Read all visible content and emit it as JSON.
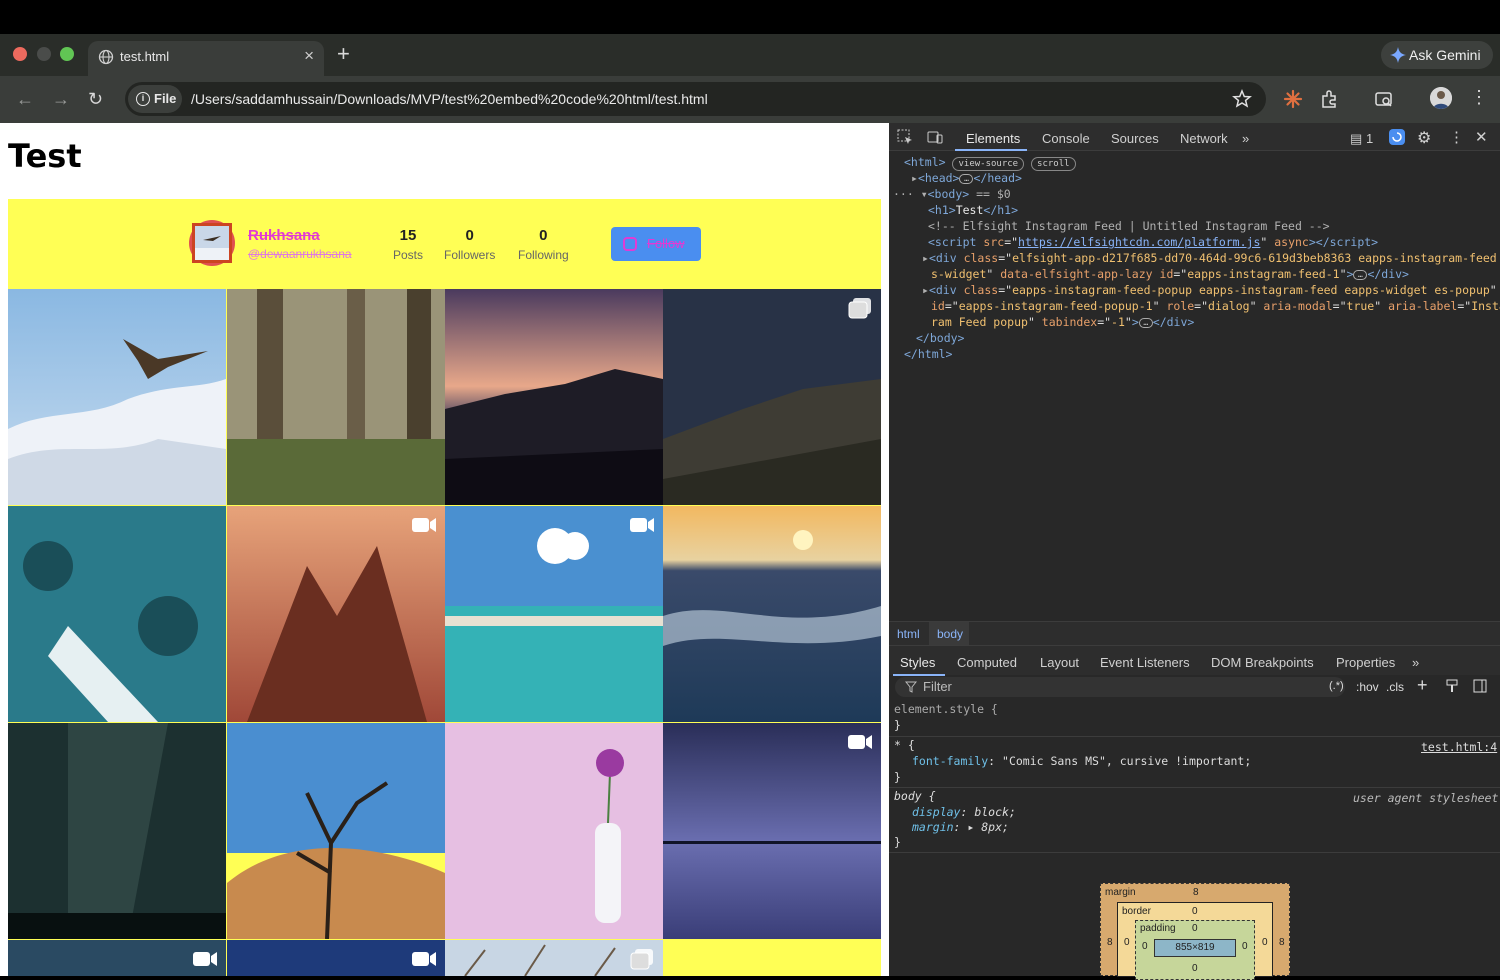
{
  "browser": {
    "tab_title": "test.html",
    "new_tab_symbol": "+",
    "gemini_label": "Ask Gemini",
    "file_chip": "File",
    "url": "/Users/saddamhussain/Downloads/MVP/test%20embed%20code%20html/test.html"
  },
  "page": {
    "heading": "Test",
    "profile": {
      "name": "Rukhsana",
      "handle": "@dewaanrukhsana",
      "posts": "15",
      "posts_label": "Posts",
      "followers": "0",
      "followers_label": "Followers",
      "following": "0",
      "following_label": "Following",
      "follow_label": "Follow"
    }
  },
  "devtools": {
    "tabs": [
      "Elements",
      "Console",
      "Sources",
      "Network"
    ],
    "issues_count": "1",
    "breadcrumb": [
      "html",
      "body"
    ],
    "style_tabs": [
      "Styles",
      "Computed",
      "Layout",
      "Event Listeners",
      "DOM Breakpoints",
      "Properties"
    ],
    "filter_placeholder": "Filter",
    "filter_controls": [
      ":hov",
      ".cls"
    ],
    "regex_toggle": "(.*)",
    "dom": {
      "view_source": "view-source",
      "scroll": "scroll",
      "body_selected": "== $0",
      "h1_text": "Test",
      "comment": "<!-- Elfsight Instagram Feed | Untitled Instagram Feed -->",
      "script_src": "https://elfsightcdn.com/platform.js",
      "div1_class": "elfsight-app-d217f685-dd70-464d-99c6-619d3beb8363 eapps-instagram-feed e",
      "div1_class_cont": "s-widget",
      "div1_id": "eapps-instagram-feed-1",
      "div2_class": "eapps-instagram-feed-popup eapps-instagram-feed eapps-widget es-popup",
      "div2_id": "eapps-instagram-feed-popup-1",
      "div2_role": "dialog",
      "div2_aria_modal": "true",
      "div2_aria_label": "Instag",
      "div2_aria_label_cont": "ram Feed popup",
      "div2_tabindex": "-1"
    },
    "styles": {
      "element_style": "element.style {",
      "rule1_selector": "* {",
      "rule1_source": "test.html:4",
      "rule1_prop": "font-family",
      "rule1_value": "\"Comic Sans MS\", cursive !important;",
      "rule2_selector": "body {",
      "rule2_source": "user agent stylesheet",
      "rule2_prop1": "display",
      "rule2_val1": "block;",
      "rule2_prop2": "margin",
      "rule2_val2": "8px;"
    },
    "box_model": {
      "margin_label": "margin",
      "margin_value": "8",
      "border_label": "border",
      "border_value": "0",
      "padding_label": "padding",
      "padding_value": "0",
      "content_size": "855×819",
      "side_margin": "8",
      "side_zero": "0"
    }
  },
  "colors": {
    "feed_background": "#ffff55",
    "accent_pink": "#e23ad4",
    "follow_button": "#4a8ef0",
    "devtools_background": "#282828"
  }
}
